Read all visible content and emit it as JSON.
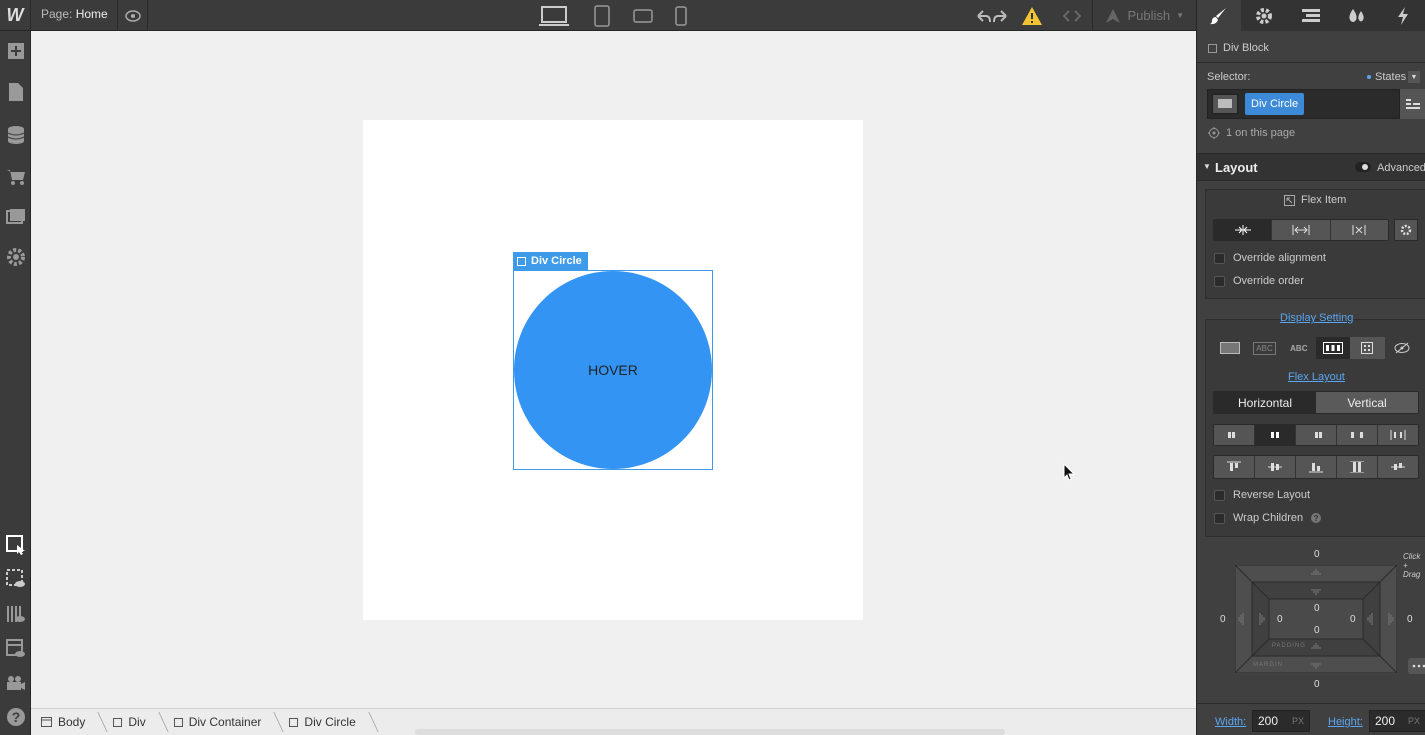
{
  "app": {
    "logo": "W"
  },
  "topbar": {
    "page_prefix": "Page:",
    "page_name": "Home",
    "publish_label": "Publish"
  },
  "canvas": {
    "element_tag": "Div Circle",
    "circle_text": "HOVER"
  },
  "breadcrumb": [
    {
      "label": "Body"
    },
    {
      "label": "Div"
    },
    {
      "label": "Div Container"
    },
    {
      "label": "Div Circle"
    }
  ],
  "panel": {
    "element_type": "Div Block",
    "selector_label": "Selector:",
    "states_label": "States",
    "selector_chip": "Div Circle",
    "count_text": "1 on this page",
    "layout_title": "Layout",
    "advanced_label": "Advanced",
    "flex_item_title": "Flex Item",
    "override_alignment": "Override alignment",
    "override_order": "Override order",
    "display_setting": "Display Setting",
    "display_options": [
      "ABC",
      "ABC"
    ],
    "flex_layout": "Flex Layout",
    "direction_horizontal": "Horizontal",
    "direction_vertical": "Vertical",
    "reverse_layout": "Reverse Layout",
    "wrap_children": "Wrap Children",
    "drag_hint": "Click + Drag",
    "box_model": {
      "margin_top": "0",
      "margin_left": "0",
      "margin_right": "0",
      "margin_bottom": "0",
      "padding_top": "0",
      "padding_left": "0",
      "padding_right": "0",
      "padding_bottom": "0",
      "margin_label": "MARGIN",
      "padding_label": "PADDING"
    },
    "width_label": "Width:",
    "width_value": "200",
    "width_unit": "PX",
    "height_label": "Height:",
    "height_value": "200",
    "height_unit": "PX"
  }
}
